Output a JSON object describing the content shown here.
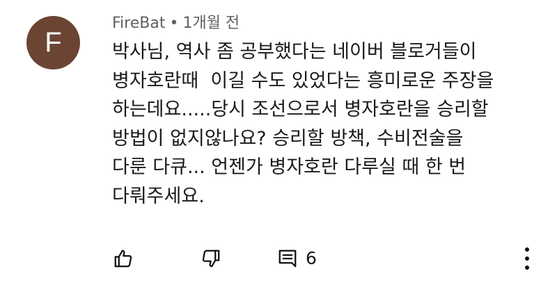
{
  "comment": {
    "avatar_initial": "F",
    "avatar_color": "#6b4434",
    "author": "FireBat",
    "separator": "•",
    "timestamp": "1개월 전",
    "lines": [
      "박사님, 역사 좀 공부했다는 네이버 블로거들이",
      "병자호란때  이길 수도 있었다는 흥미로운 주장을",
      "하는데요.....당시 조선으로서 병자호란을 승리할",
      "방법이 없지않나요? 승리할 방책, 수비전술을",
      "다룬 다큐... 언젠가 병자호란 다루실 때 한 번",
      "다뤄주세요."
    ],
    "reply_count": "6"
  },
  "icons": {
    "like": "thumbs-up-icon",
    "dislike": "thumbs-down-icon",
    "reply": "comment-icon",
    "more": "more-vertical-icon"
  }
}
